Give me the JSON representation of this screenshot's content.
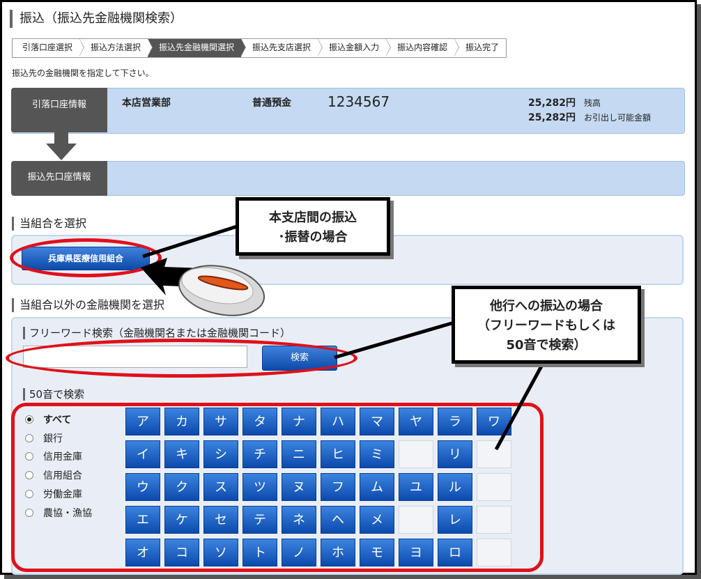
{
  "page": {
    "title": "振込（振込先金融機関検索）",
    "instruction": "振込先の金融機関を指定して下さい。"
  },
  "steps": [
    {
      "label": "引落口座選択",
      "active": false
    },
    {
      "label": "振込方法選択",
      "active": false
    },
    {
      "label": "振込先金融機関選択",
      "active": true
    },
    {
      "label": "振込先支店選択",
      "active": false
    },
    {
      "label": "振込金額入力",
      "active": false
    },
    {
      "label": "振込内容確認",
      "active": false
    },
    {
      "label": "振込完了",
      "active": false
    }
  ],
  "account": {
    "label": "引落口座情報",
    "branch": "本店営業部",
    "type": "普通預金",
    "number": "1234567",
    "balance_amount": "25,282円",
    "balance_label": "残高",
    "available_amount": "25,282円",
    "available_label": "お引出し可能金額"
  },
  "destination": {
    "label": "振込先口座情報"
  },
  "own_union": {
    "heading": "当組合を選択",
    "button": "兵庫県医療信用組合"
  },
  "other": {
    "heading": "当組合以外の金融機関を選択",
    "freeword_heading": "フリーワード検索（金融機関名または金融機関コード）",
    "freeword_value": "",
    "search_button": "検索",
    "kana_heading": "50音で検索"
  },
  "filters": [
    {
      "label": "すべて",
      "checked": true
    },
    {
      "label": "銀行",
      "checked": false
    },
    {
      "label": "信用金庫",
      "checked": false
    },
    {
      "label": "信用組合",
      "checked": false
    },
    {
      "label": "労働金庫",
      "checked": false
    },
    {
      "label": "農協・漁協",
      "checked": false
    }
  ],
  "kana_rows": [
    [
      "ア",
      "カ",
      "サ",
      "タ",
      "ナ",
      "ハ",
      "マ",
      "ヤ",
      "ラ",
      "ワ"
    ],
    [
      "イ",
      "キ",
      "シ",
      "チ",
      "ニ",
      "ヒ",
      "ミ",
      "",
      "リ",
      ""
    ],
    [
      "ウ",
      "ク",
      "ス",
      "ツ",
      "ヌ",
      "フ",
      "ム",
      "ユ",
      "ル",
      ""
    ],
    [
      "エ",
      "ケ",
      "セ",
      "テ",
      "ネ",
      "ヘ",
      "メ",
      "",
      "レ",
      ""
    ],
    [
      "オ",
      "コ",
      "ソ",
      "ト",
      "ノ",
      "ホ",
      "モ",
      "ヨ",
      "ロ",
      ""
    ]
  ],
  "callouts": {
    "own": [
      "本支店間の振込",
      "･振替の場合"
    ],
    "other": [
      "他行への振込の場合",
      "（フリーワードもしくは",
      "50音で検索）"
    ]
  },
  "colors": {
    "accent_blue": "#0d4aa8",
    "panel_blue": "#c5daf2",
    "annotation_red": "#e0101a",
    "dark_label": "#555555"
  },
  "icons": [
    "mouse-icon",
    "pointer-arrow-icon",
    "down-arrow-icon"
  ]
}
